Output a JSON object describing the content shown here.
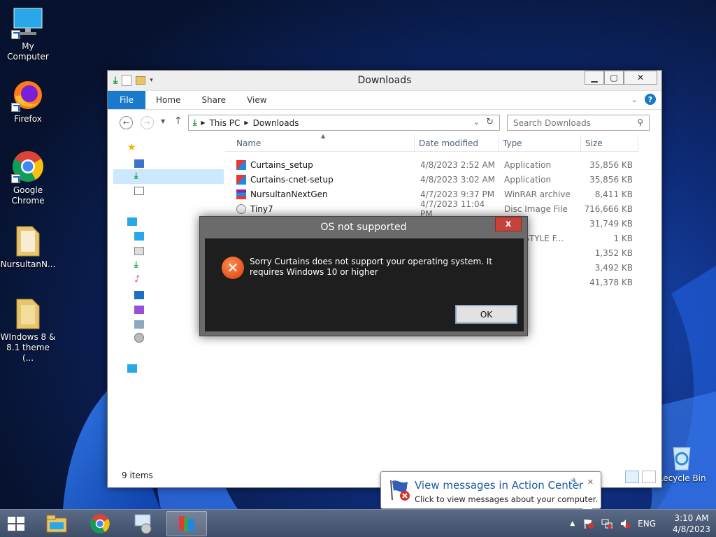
{
  "desktop": {
    "icons": [
      {
        "label": "My Computer"
      },
      {
        "label": "Firefox"
      },
      {
        "label": "Google Chrome"
      },
      {
        "label": "NursultanN..."
      },
      {
        "label": "WIndows 8 & 8.1 theme (..."
      },
      {
        "label": "Recycle Bin"
      }
    ]
  },
  "explorer": {
    "title": "Downloads",
    "ribbon_tabs": [
      "File",
      "Home",
      "Share",
      "View"
    ],
    "address": {
      "crumbs": [
        "This PC",
        "Downloads"
      ]
    },
    "search": {
      "placeholder": "Search Downloads"
    },
    "columns": [
      "Name",
      "Date modified",
      "Type",
      "Size"
    ],
    "files": [
      {
        "name": "Curtains_setup",
        "date": "4/8/2023 2:52 AM",
        "type": "Application",
        "size": "35,856 KB"
      },
      {
        "name": "Curtains-cnet-setup",
        "date": "4/8/2023 3:02 AM",
        "type": "Application",
        "size": "35,856 KB"
      },
      {
        "name": "NursultanNextGen",
        "date": "4/7/2023 9:37 PM",
        "type": "WinRAR archive",
        "size": "8,411 KB"
      },
      {
        "name": "Tiny7",
        "date": "4/7/2023 11:04 PM",
        "type": "Disc Image File",
        "size": "716,666 KB"
      },
      {
        "name": "",
        "date": "",
        "type": "e",
        "size": "31,749 KB"
      },
      {
        "name": "",
        "date": "",
        "type": "AINSSTYLE F...",
        "size": "1 KB"
      },
      {
        "name": "",
        "date": "",
        "type": "mage",
        "size": "1,352 KB"
      },
      {
        "name": "",
        "date": "",
        "type": "ation",
        "size": "3,492 KB"
      },
      {
        "name": "",
        "date": "",
        "type": "ation",
        "size": "41,378 KB"
      }
    ],
    "status": "9 items"
  },
  "dialog": {
    "title": "OS not supported",
    "close": "x",
    "message": "Sorry Curtains does not support your operating system.  It requires Windows 10 or higher",
    "ok": "OK"
  },
  "balloon": {
    "title": "View messages in Action Center",
    "text": "Click to view messages about your computer."
  },
  "taskbar": {
    "lang": "ENG",
    "time": "3:10 AM",
    "date": "4/8/2023"
  },
  "colors": {
    "accent": "#1979ca",
    "dialog_close": "#c6423a",
    "error_orange": "#e8531d",
    "balloon_title": "#1b5aa5"
  }
}
